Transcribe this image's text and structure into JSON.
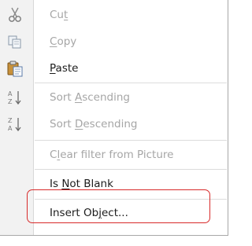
{
  "context_menu": {
    "items": [
      {
        "id": "cut",
        "pre": "Cu",
        "u": "t",
        "post": "",
        "enabled": false,
        "icon": "scissors-icon"
      },
      {
        "id": "copy",
        "pre": "",
        "u": "C",
        "post": "opy",
        "enabled": false,
        "icon": "copy-icon"
      },
      {
        "id": "paste",
        "pre": "",
        "u": "P",
        "post": "aste",
        "enabled": true,
        "icon": "paste-icon"
      },
      {
        "id": "sort-ascending",
        "pre": "Sort ",
        "u": "A",
        "post": "scending",
        "enabled": false,
        "icon": "sort-ascending-icon"
      },
      {
        "id": "sort-descending",
        "pre": "Sort ",
        "u": "D",
        "post": "escending",
        "enabled": false,
        "icon": "sort-descending-icon"
      },
      {
        "id": "clear-filter",
        "pre": "C",
        "u": "l",
        "post": "ear filter from Picture",
        "enabled": false,
        "icon": ""
      },
      {
        "id": "is-not-blank",
        "pre": "Is ",
        "u": "N",
        "post": "ot Blank",
        "enabled": true,
        "icon": ""
      },
      {
        "id": "insert-object",
        "pre": "Insert Ob",
        "u": "j",
        "post": "ect...",
        "enabled": true,
        "icon": ""
      }
    ]
  },
  "colors": {
    "highlight_border": "#d82a2a",
    "disabled_text": "#a6a6a6",
    "enabled_text": "#1c1c1c"
  }
}
